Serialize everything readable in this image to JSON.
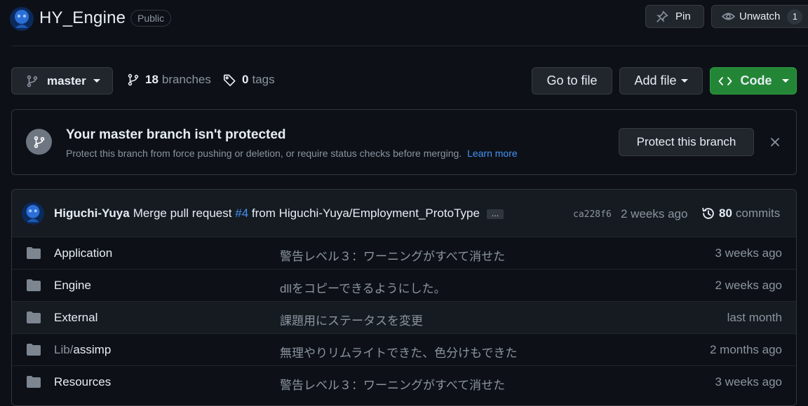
{
  "header": {
    "repo_name": "HY_Engine",
    "visibility": "Public",
    "pin_label": "Pin",
    "watch_label": "Unwatch",
    "watch_count": "1"
  },
  "branch_bar": {
    "current_branch": "master",
    "branches_count": "18",
    "branches_label": "branches",
    "tags_count": "0",
    "tags_label": "tags",
    "go_to_file": "Go to file",
    "add_file": "Add file",
    "code": "Code"
  },
  "banner": {
    "title": "Your master branch isn't protected",
    "description": "Protect this branch from force pushing or deletion, or require status checks before merging.",
    "learn_more": "Learn more",
    "button": "Protect this branch"
  },
  "commit": {
    "author": "Higuchi-Yuya",
    "message_prefix": "Merge pull request",
    "pr": "#4",
    "message_suffix": "from Higuchi-Yuya/Employment_ProtoType",
    "ellipsis": "…",
    "sha": "ca228f6",
    "time": "2 weeks ago",
    "count": "80",
    "count_label": "commits"
  },
  "files": [
    {
      "name_prefix": "",
      "name": "Application",
      "message": "警告レベル３：ワーニングがすべて消せた",
      "age": "3 weeks ago"
    },
    {
      "name_prefix": "",
      "name": "Engine",
      "message": "dllをコピーできるようにした。",
      "age": "2 weeks ago"
    },
    {
      "name_prefix": "",
      "name": "External",
      "message": "課題用にステータスを変更",
      "age": "last month"
    },
    {
      "name_prefix": "Lib/",
      "name": "assimp",
      "message": "無理やりリムライトできた、色分けもできた",
      "age": "2 months ago"
    },
    {
      "name_prefix": "",
      "name": "Resources",
      "message": "警告レベル３：ワーニングがすべて消せた",
      "age": "3 weeks ago"
    }
  ],
  "colors": {
    "background": "#0d1117",
    "accent_green": "#238636",
    "link_blue": "#4493f8"
  },
  "icons": [
    "avatar",
    "pin-icon",
    "eye-icon",
    "branch-icon",
    "tag-icon",
    "code-icon",
    "close-icon",
    "history-icon",
    "folder-icon"
  ]
}
